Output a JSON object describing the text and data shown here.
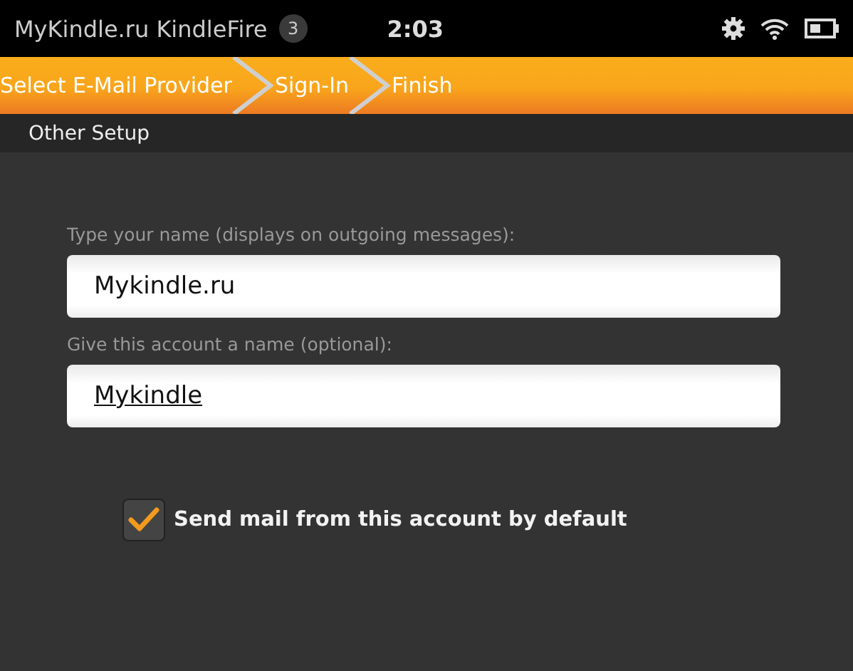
{
  "status_bar": {
    "title": "MyKindle.ru KindleFire",
    "notification_count": "3",
    "time": "2:03"
  },
  "steps": [
    {
      "label": "Select E-Mail Provider"
    },
    {
      "label": "Sign-In"
    },
    {
      "label": "Finish"
    }
  ],
  "section_title": "Other Setup",
  "fields": [
    {
      "label": "Type your name (displays on outgoing messages):",
      "value": "Mykindle.ru",
      "underlined": false
    },
    {
      "label": "Give this account a name (optional):",
      "value": "Mykindle",
      "underlined": true
    }
  ],
  "default_account": {
    "label": "Send mail from this account by default",
    "checked": true
  }
}
